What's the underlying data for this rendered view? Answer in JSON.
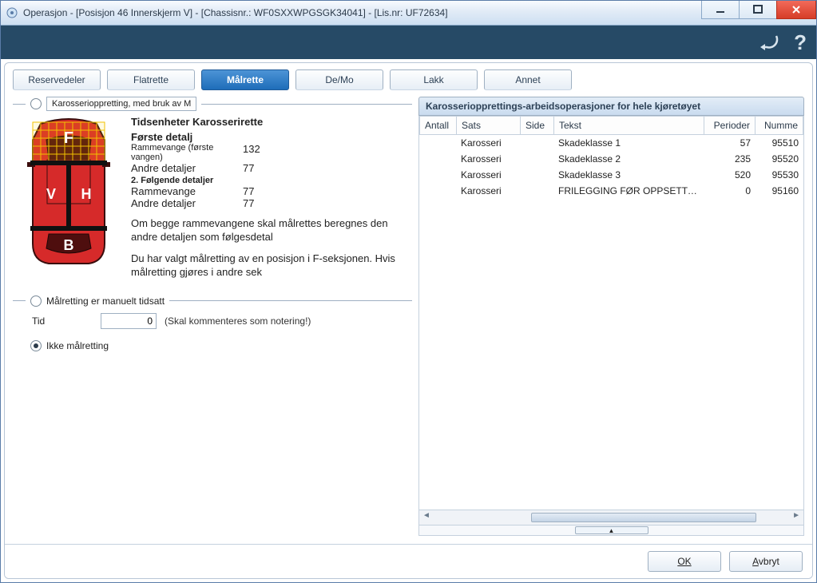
{
  "window": {
    "title": "Operasjon -  [Posisjon 46 Innerskjerm V] -  [Chassisnr.: WF0SXXWPGSGK34041] -   [Lis.nr: UF72634]"
  },
  "tabs": [
    {
      "label": "Reservedeler"
    },
    {
      "label": "Flatrette"
    },
    {
      "label": "Målrette"
    },
    {
      "label": "De/Mo"
    },
    {
      "label": "Lakk"
    },
    {
      "label": "Annet"
    }
  ],
  "group1": {
    "legend": "Karosserioppretting, med bruk av M",
    "header": "Tidsenheter Karosserirette",
    "first_label": "Første detalj",
    "row1_label": "Rammevange (første vangen)",
    "row1_value": "132",
    "row2_label": "Andre detaljer",
    "row2_value": "77",
    "second_label": "2. Følgende detaljer",
    "row3_label": "Rammevange",
    "row3_value": "77",
    "row4_label": "Andre detaljer",
    "row4_value": "77",
    "note1": "Om begge rammevangene skal målrettes beregnes den andre detaljen som følgesdetal",
    "note2": "Du har valgt målretting av en posisjon i F-seksjonen. Hvis målretting gjøres i andre sek"
  },
  "group2": {
    "legend": "Målretting er manuelt tidsatt",
    "tid_label": "Tid",
    "tid_value": "0",
    "hint": "(Skal kommenteres som notering!)",
    "none_label": "Ikke målretting"
  },
  "car": {
    "zones": {
      "f": "F",
      "v": "V",
      "h": "H",
      "b": "B"
    }
  },
  "right_panel": {
    "title": "Karosseriopprettings-arbeidsoperasjoner for hele kjøretøyet",
    "columns": {
      "antall": "Antall",
      "sats": "Sats",
      "side": "Side",
      "tekst": "Tekst",
      "perioder": "Perioder",
      "nummer": "Numme"
    },
    "rows": [
      {
        "antall": "",
        "sats": "Karosseri",
        "side": "",
        "tekst": "Skadeklasse 1",
        "perioder": "57",
        "nummer": "95510"
      },
      {
        "antall": "",
        "sats": "Karosseri",
        "side": "",
        "tekst": "Skadeklasse 2",
        "perioder": "235",
        "nummer": "95520"
      },
      {
        "antall": "",
        "sats": "Karosseri",
        "side": "",
        "tekst": "Skadeklasse 3",
        "perioder": "520",
        "nummer": "95530"
      },
      {
        "antall": "",
        "sats": "Karosseri",
        "side": "",
        "tekst": "FRILEGGING FØR OPPSETT I BENK - DEMO",
        "perioder": "0",
        "nummer": "95160"
      }
    ]
  },
  "footer": {
    "ok": "OK",
    "cancel_pre": "A",
    "cancel_rest": "vbryt"
  }
}
